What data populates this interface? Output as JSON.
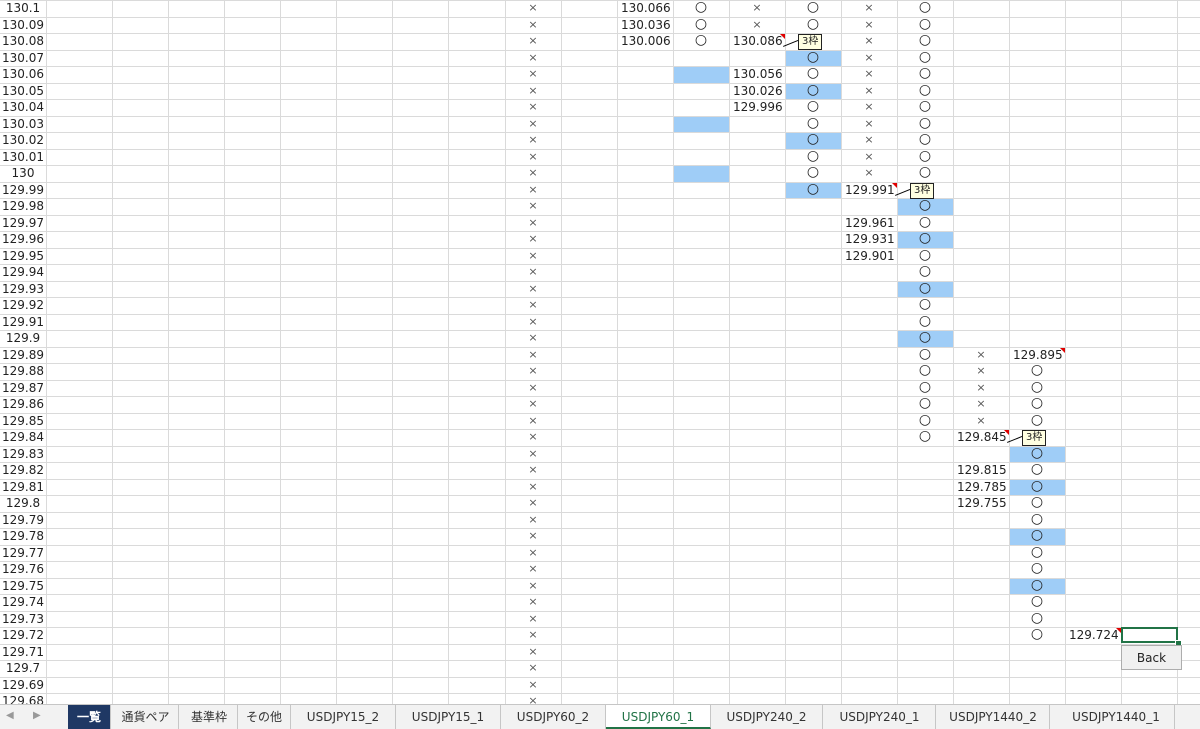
{
  "rows": [
    "130.1",
    "130.09",
    "130.08",
    "130.07",
    "130.06",
    "130.05",
    "130.04",
    "130.03",
    "130.02",
    "130.01",
    "130",
    "129.99",
    "129.98",
    "129.97",
    "129.96",
    "129.95",
    "129.94",
    "129.93",
    "129.92",
    "129.91",
    "129.9",
    "129.89",
    "129.88",
    "129.87",
    "129.86",
    "129.85",
    "129.84",
    "129.83",
    "129.82",
    "129.81",
    "129.8",
    "129.79",
    "129.78",
    "129.77",
    "129.76",
    "129.75",
    "129.74",
    "129.73",
    "129.72",
    "129.71",
    "129.7",
    "129.69",
    "129.68"
  ],
  "symbols": {
    "cross": "×",
    "circle": "○"
  },
  "columns": [
    {
      "name": "col-e",
      "cross_from": 0,
      "cross_to": 42,
      "circle_from": null,
      "circle_to": null,
      "fills": []
    },
    {
      "name": "col-h",
      "cross_from": null,
      "cross_to": null,
      "circle_from": 0,
      "circle_to": 2,
      "fills": [
        4,
        7,
        10
      ]
    },
    {
      "name": "col-i",
      "cross_from": 0,
      "cross_to": 1,
      "circle_from": null,
      "circle_to": null,
      "fills": []
    },
    {
      "name": "col-j",
      "cross_from": null,
      "cross_to": null,
      "circle_from": 0,
      "circle_to": 11,
      "fills": [
        3,
        5,
        8,
        11
      ]
    },
    {
      "name": "col-k",
      "cross_from": 0,
      "cross_to": 10,
      "circle_from": null,
      "circle_to": null,
      "fills": []
    },
    {
      "name": "col-l",
      "cross_from": null,
      "cross_to": null,
      "circle_from": 0,
      "circle_to": 26,
      "fills": [
        12,
        14,
        17,
        20
      ]
    },
    {
      "name": "col-m",
      "cross_from": 21,
      "cross_to": 25,
      "circle_from": null,
      "circle_to": null,
      "fills": []
    },
    {
      "name": "col-n",
      "cross_from": null,
      "cross_to": null,
      "circle_from": 22,
      "circle_to": 38,
      "fills": [
        27,
        29,
        32,
        35
      ]
    }
  ],
  "values": [
    {
      "col": "col-g",
      "row": 0,
      "text": "130.066"
    },
    {
      "col": "col-g",
      "row": 1,
      "text": "130.036"
    },
    {
      "col": "col-g",
      "row": 2,
      "text": "130.006"
    },
    {
      "col": "col-i",
      "row": 2,
      "text": "130.086"
    },
    {
      "col": "col-i",
      "row": 4,
      "text": "130.056"
    },
    {
      "col": "col-i",
      "row": 5,
      "text": "130.026"
    },
    {
      "col": "col-i",
      "row": 6,
      "text": "129.996"
    },
    {
      "col": "col-k",
      "row": 11,
      "text": "129.991"
    },
    {
      "col": "col-k",
      "row": 13,
      "text": "129.961"
    },
    {
      "col": "col-k",
      "row": 14,
      "text": "129.931"
    },
    {
      "col": "col-k",
      "row": 15,
      "text": "129.901"
    },
    {
      "col": "col-n",
      "row": 21,
      "text": "129.895"
    },
    {
      "col": "col-m",
      "row": 26,
      "text": "129.845"
    },
    {
      "col": "col-m",
      "row": 28,
      "text": "129.815"
    },
    {
      "col": "col-m",
      "row": 29,
      "text": "129.785"
    },
    {
      "col": "col-m",
      "row": 30,
      "text": "129.755"
    },
    {
      "col": "col-o",
      "row": 38,
      "text": "129.724"
    }
  ],
  "comments": [
    {
      "col": "col-j",
      "row": 2,
      "text": "3枠"
    },
    {
      "col": "col-l",
      "row": 11,
      "text": "3枠"
    },
    {
      "col": "col-n",
      "row": 26,
      "text": "3枠"
    }
  ],
  "back_button": "Back",
  "tabs": [
    {
      "label": "一覧",
      "state": "dark"
    },
    {
      "label": "通貨ペア",
      "state": ""
    },
    {
      "label": "基準枠",
      "state": ""
    },
    {
      "label": "その他",
      "state": ""
    },
    {
      "label": "USDJPY15_2",
      "state": ""
    },
    {
      "label": "USDJPY15_1",
      "state": ""
    },
    {
      "label": "USDJPY60_2",
      "state": ""
    },
    {
      "label": "USDJPY60_1",
      "state": "active"
    },
    {
      "label": "USDJPY240_2",
      "state": ""
    },
    {
      "label": "USDJPY240_1",
      "state": ""
    },
    {
      "label": "USDJPY1440_2",
      "state": ""
    },
    {
      "label": "USDJPY1440_1",
      "state": ""
    }
  ],
  "nav": {
    "prev": "◀",
    "next": "▶"
  },
  "colors": {
    "fill": "#9fcdf7",
    "comment_marker": "#e00000",
    "active_tab": "#217346",
    "first_tab": "#1f3864"
  }
}
